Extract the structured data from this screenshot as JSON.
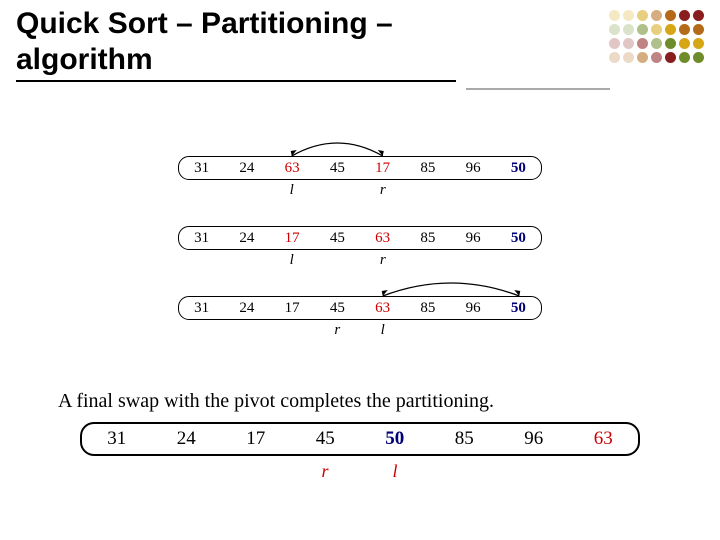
{
  "title": "Quick Sort – Partitioning – algorithm",
  "caption": "A final swap with the pivot completes the partitioning.",
  "dot_colors": [
    "#8a1d1d",
    "#b56a1a",
    "#d6a615",
    "#6f8c2b"
  ],
  "steps": [
    {
      "values": [
        31,
        24,
        63,
        45,
        17,
        85,
        96,
        50
      ],
      "highlight": {
        "2": "red",
        "4": "red",
        "7": "blue"
      },
      "markers": {
        "2": "l",
        "4": "r"
      },
      "arc": {
        "from": 2,
        "to": 4
      }
    },
    {
      "values": [
        31,
        24,
        17,
        45,
        63,
        85,
        96,
        50
      ],
      "highlight": {
        "2": "red",
        "4": "red",
        "7": "blue"
      },
      "markers": {
        "2": "l",
        "4": "r"
      },
      "arc": null
    },
    {
      "values": [
        31,
        24,
        17,
        45,
        63,
        85,
        96,
        50
      ],
      "highlight": {
        "4": "red",
        "7": "blue"
      },
      "markers": {
        "3": "r",
        "4": "l"
      },
      "arc": {
        "from": 4,
        "to": 7
      }
    }
  ],
  "result": {
    "values": [
      31,
      24,
      17,
      45,
      50,
      85,
      96,
      63
    ],
    "highlight": {
      "4": "blue",
      "7": "red"
    },
    "markers": {
      "3": "r",
      "4": "l"
    }
  }
}
